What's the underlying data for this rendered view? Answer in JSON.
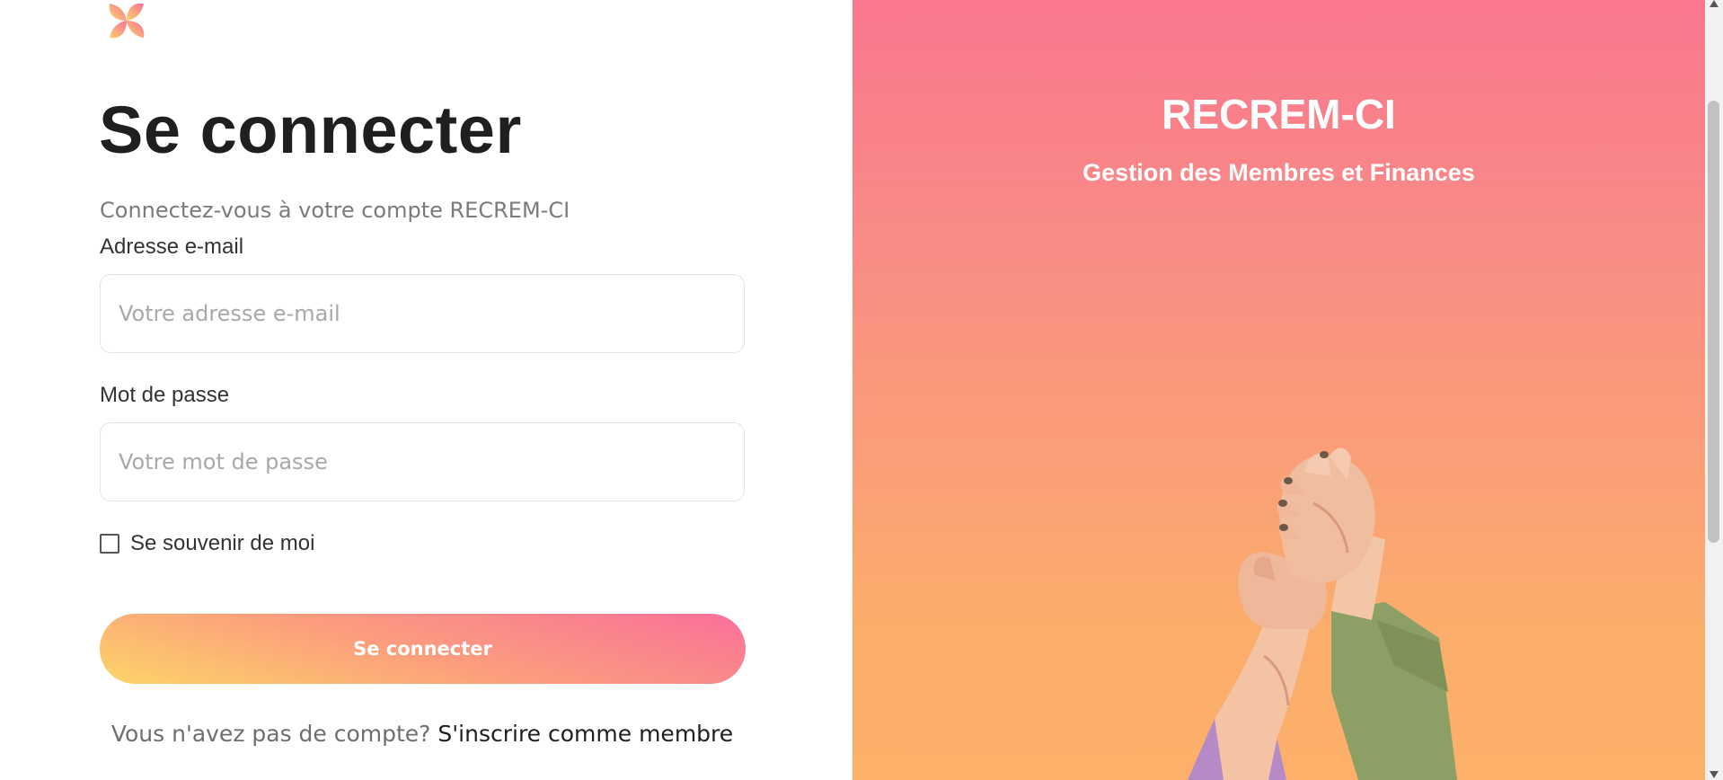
{
  "login": {
    "title": "Se connecter",
    "subtitle": "Connectez-vous à votre compte RECREM-CI",
    "email_label": "Adresse e-mail",
    "email_placeholder": "Votre adresse e-mail",
    "email_value": "",
    "password_label": "Mot de passe",
    "password_placeholder": "Votre mot de passe",
    "password_value": "",
    "remember_label": "Se souvenir de moi",
    "remember_checked": false,
    "submit_label": "Se connecter",
    "signup_prompt": "Vous n'avez pas de compte?",
    "signup_link": "S'inscrire comme membre"
  },
  "hero": {
    "title": "RECREM-CI",
    "subtitle": "Gestion des Membres et Finances",
    "image": "hands-clasped-photo"
  },
  "icons": {
    "logo": "pinwheel-logo-icon",
    "checkbox": "checkbox-icon"
  },
  "colors": {
    "accent_pink": "#f9709a",
    "accent_orange": "#fca07c",
    "accent_yellow": "#fdd468"
  }
}
